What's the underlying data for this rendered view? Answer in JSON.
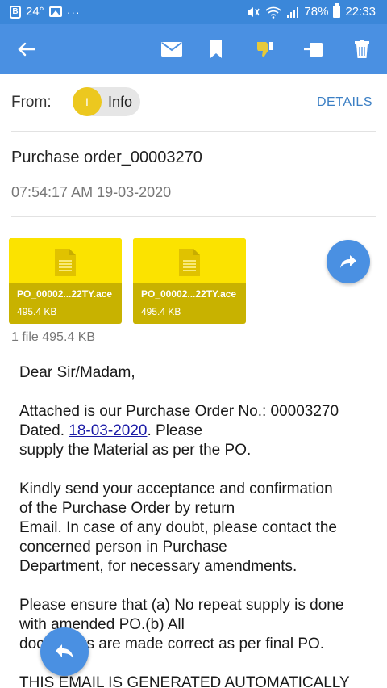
{
  "status_bar": {
    "temperature": "24°",
    "dots": "···",
    "battery": "78%",
    "time": "22:33"
  },
  "toolbar": {
    "icons": [
      "back-arrow-icon",
      "mail-icon",
      "bookmark-icon",
      "thumbs-down-icon",
      "move-icon",
      "trash-icon"
    ]
  },
  "header": {
    "from_label": "From:",
    "sender_initial": "I",
    "sender_name": "Info",
    "details_label": "DETAILS",
    "subject": "Purchase order_00003270",
    "timestamp": "07:54:17 AM 19-03-2020"
  },
  "attachments": {
    "items": [
      {
        "name": "PO_00002...22TY.ace",
        "size": "495.4 KB"
      },
      {
        "name": "PO_00002...22TY.ace",
        "size": "495.4 KB"
      }
    ],
    "summary": "1 file 495.4 KB"
  },
  "body": {
    "greeting": "Dear Sir/Madam,",
    "p1_line1": "Attached is our Purchase Order No.: 00003270",
    "p1_line2_pre": "Dated. ",
    "p1_date": "18-03-2020",
    "p1_line2_post": ". Please",
    "p1_line3": "supply the Material as per the PO.",
    "p2_line1": "Kindly send your acceptance and confirmation",
    "p2_line2": "of the Purchase Order by return",
    "p2_line3": "Email. In case of any doubt, please contact the",
    "p2_line4": "concerned person in Purchase",
    "p2_line5": "Department, for necessary amendments.",
    "p3_line1": "Please ensure that (a) No repeat supply is done",
    "p3_line2": "with amended PO.(b) All",
    "p3_line3": "documents are made correct as per final PO.",
    "p4_line1": "THIS EMAIL IS GENERATED AUTOMATICALLY"
  },
  "colors": {
    "toolbar": "#4a90e2",
    "status_bar": "#3b87d9",
    "attachment_top": "#fbe300",
    "attachment_bottom": "#c8b200",
    "avatar": "#ecc81f"
  }
}
